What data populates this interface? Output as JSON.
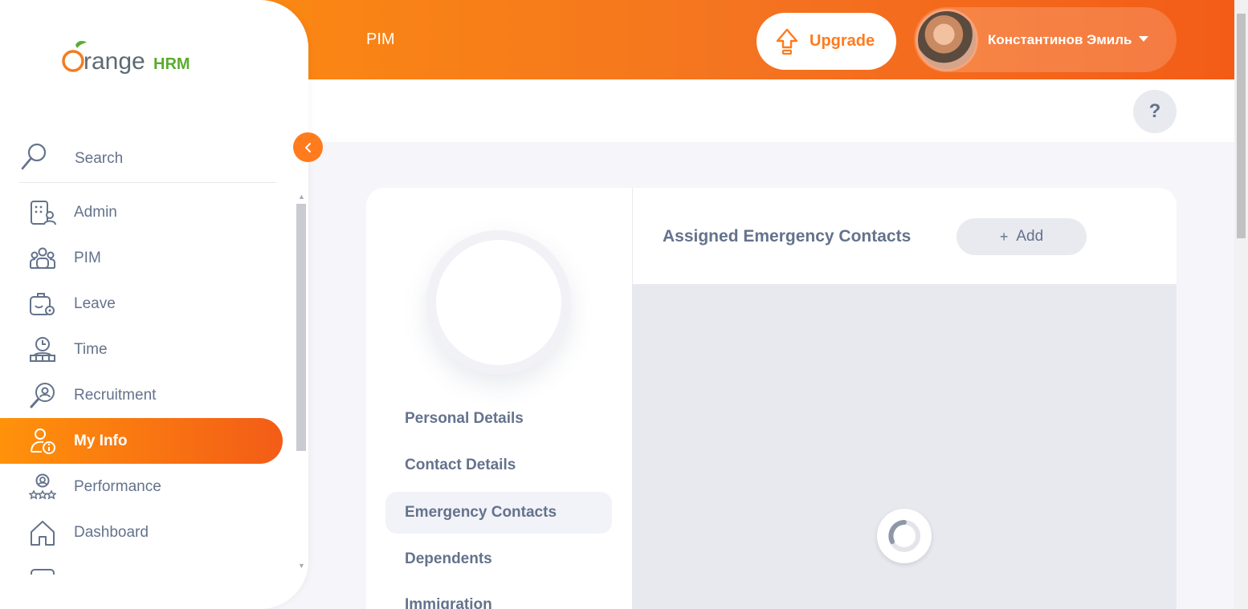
{
  "header": {
    "title": "PIM",
    "upgrade_label": "Upgrade",
    "user_name": "Константинов Эмиль"
  },
  "help": {
    "label": "?"
  },
  "sidebar": {
    "logo_text_orange": "range",
    "logo_text_hrm": "HRM",
    "search_label": "Search",
    "items": [
      {
        "label": "Admin",
        "icon": "admin-icon"
      },
      {
        "label": "PIM",
        "icon": "pim-icon"
      },
      {
        "label": "Leave",
        "icon": "leave-icon"
      },
      {
        "label": "Time",
        "icon": "time-icon"
      },
      {
        "label": "Recruitment",
        "icon": "recruitment-icon"
      },
      {
        "label": "My Info",
        "icon": "my-info-icon",
        "active": true
      },
      {
        "label": "Performance",
        "icon": "performance-icon"
      },
      {
        "label": "Dashboard",
        "icon": "dashboard-icon"
      }
    ]
  },
  "profile_tabs": [
    {
      "label": "Personal Details"
    },
    {
      "label": "Contact Details"
    },
    {
      "label": "Emergency Contacts",
      "active": true
    },
    {
      "label": "Dependents"
    },
    {
      "label": "Immigration"
    }
  ],
  "main": {
    "section_title": "Assigned Emergency Contacts",
    "add_label": "Add",
    "add_symbol": "+"
  },
  "colors": {
    "accent": "#ff7b1d",
    "gradient_start": "#ff920b",
    "gradient_end": "#f35c17",
    "text": "#64728c"
  }
}
